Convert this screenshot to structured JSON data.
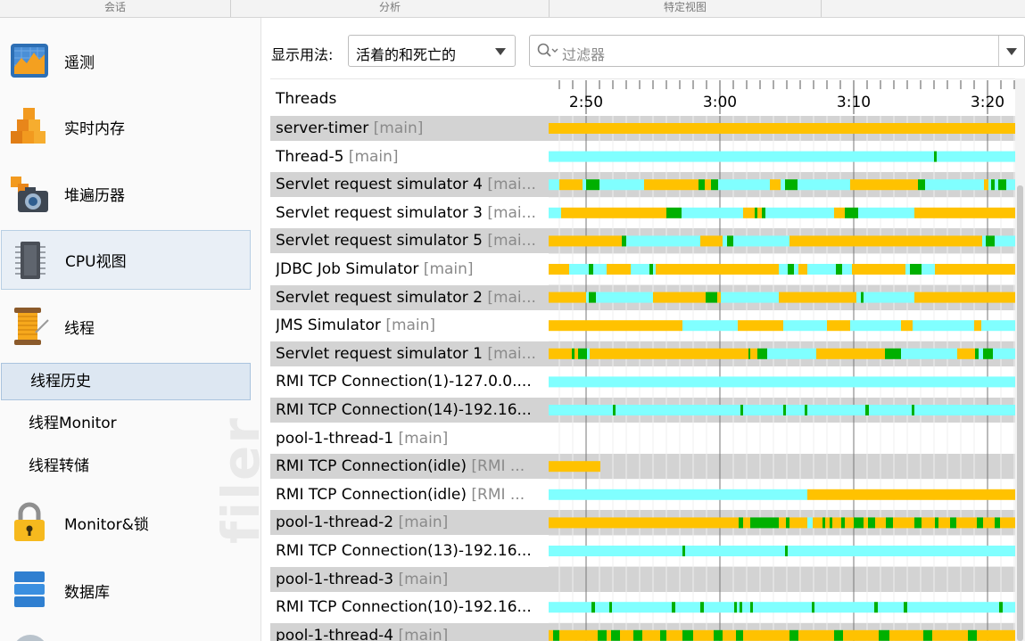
{
  "topbar": {
    "sections": [
      "会话",
      "分析",
      "特定视图"
    ]
  },
  "sidebar": {
    "items": [
      {
        "label": "遥测",
        "icon": "telemetry-chart-icon"
      },
      {
        "label": "实时内存",
        "icon": "live-memory-blocks-icon"
      },
      {
        "label": "堆遍历器",
        "icon": "heap-walker-camera-icon"
      },
      {
        "label": "CPU视图",
        "icon": "cpu-chip-icon"
      },
      {
        "label": "线程",
        "icon": "thread-spool-icon"
      },
      {
        "label": "Monitor&锁",
        "icon": "lock-icon"
      },
      {
        "label": "数据库",
        "icon": "database-icon"
      }
    ],
    "thread_subitems": [
      "线程历史",
      "线程Monitor",
      "线程转储"
    ],
    "watermark": "filer"
  },
  "toolbar": {
    "display_label": "显示用法:",
    "display_value": "活着的和死亡的",
    "filter_placeholder": "过滤器"
  },
  "timeline": {
    "header": "Threads",
    "ticks": [
      "2:50",
      "3:00",
      "3:10",
      "3:20"
    ],
    "legend_colors": {
      "waiting": "#ffc200",
      "blocked": "#80ffff",
      "runnable": "#00b000"
    },
    "threads": [
      {
        "name": "server-timer",
        "group": "[main]"
      },
      {
        "name": "Thread-5",
        "group": "[main]"
      },
      {
        "name": "Servlet request simulator 4",
        "group": "[mai..."
      },
      {
        "name": "Servlet request simulator 3",
        "group": "[mai..."
      },
      {
        "name": "Servlet request simulator 5",
        "group": "[mai..."
      },
      {
        "name": "JDBC Job Simulator",
        "group": "[main]"
      },
      {
        "name": "Servlet request simulator 2",
        "group": "[mai..."
      },
      {
        "name": "JMS Simulator",
        "group": "[main]"
      },
      {
        "name": "Servlet request simulator 1",
        "group": "[mai..."
      },
      {
        "name": "RMI TCP Connection(1)-127.0.0....",
        "group": ""
      },
      {
        "name": "RMI TCP Connection(14)-192.16...",
        "group": ""
      },
      {
        "name": "pool-1-thread-1",
        "group": "[main]"
      },
      {
        "name": "RMI TCP Connection(idle)",
        "group": "[RMI ..."
      },
      {
        "name": "RMI TCP Connection(idle)",
        "group": "[RMI ..."
      },
      {
        "name": "pool-1-thread-2",
        "group": "[main]"
      },
      {
        "name": "RMI TCP Connection(13)-192.16...",
        "group": ""
      },
      {
        "name": "pool-1-thread-3",
        "group": "[main]"
      },
      {
        "name": "RMI TCP Connection(10)-192.16...",
        "group": ""
      },
      {
        "name": "pool-1-thread-4",
        "group": "[main]"
      }
    ]
  }
}
